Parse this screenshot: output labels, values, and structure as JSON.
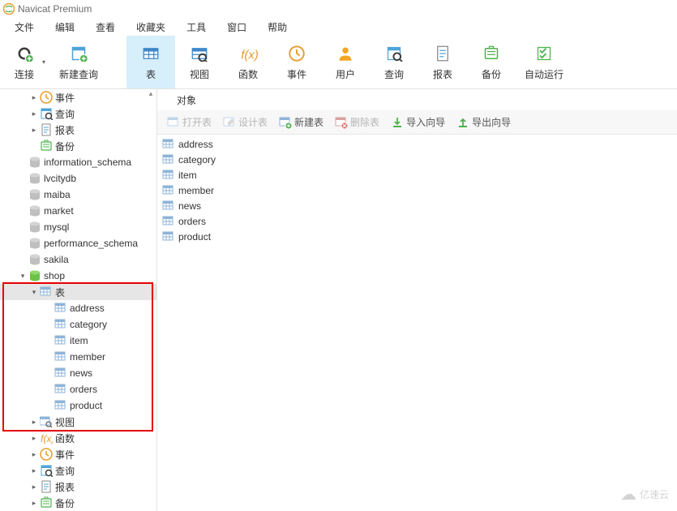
{
  "title": "Navicat Premium",
  "menu": [
    "文件",
    "编辑",
    "查看",
    "收藏夹",
    "工具",
    "窗口",
    "帮助"
  ],
  "toolbar": [
    {
      "id": "connect",
      "label": "连接"
    },
    {
      "id": "newquery",
      "label": "新建查询"
    },
    {
      "id": "table",
      "label": "表",
      "active": true
    },
    {
      "id": "view",
      "label": "视图"
    },
    {
      "id": "function",
      "label": "函数"
    },
    {
      "id": "event",
      "label": "事件"
    },
    {
      "id": "user",
      "label": "用户"
    },
    {
      "id": "query",
      "label": "查询"
    },
    {
      "id": "report",
      "label": "报表"
    },
    {
      "id": "backup",
      "label": "备份"
    },
    {
      "id": "schedule",
      "label": "自动运行"
    }
  ],
  "tree_top": [
    {
      "label": "事件",
      "icon": "event",
      "arrow": ">",
      "indent": 2
    },
    {
      "label": "查询",
      "icon": "query",
      "arrow": ">",
      "indent": 2
    },
    {
      "label": "报表",
      "icon": "report",
      "arrow": ">",
      "indent": 2
    },
    {
      "label": "备份",
      "icon": "backup",
      "arrow": "",
      "indent": 2
    }
  ],
  "databases": [
    {
      "label": "information_schema",
      "active": false
    },
    {
      "label": "lvcitydb",
      "active": false
    },
    {
      "label": "maiba",
      "active": false
    },
    {
      "label": "market",
      "active": false
    },
    {
      "label": "mysql",
      "active": false
    },
    {
      "label": "performance_schema",
      "active": false
    },
    {
      "label": "sakila",
      "active": false
    }
  ],
  "shop_db": {
    "label": "shop"
  },
  "shop_tables_node": {
    "label": "表"
  },
  "shop_tables": [
    "address",
    "category",
    "item",
    "member",
    "news",
    "orders",
    "product"
  ],
  "shop_children": [
    {
      "label": "视图",
      "icon": "view"
    },
    {
      "label": "函数",
      "icon": "fx"
    },
    {
      "label": "事件",
      "icon": "event"
    },
    {
      "label": "查询",
      "icon": "query"
    },
    {
      "label": "报表",
      "icon": "report"
    },
    {
      "label": "备份",
      "icon": "backup"
    }
  ],
  "tab_label": "对象",
  "actions": [
    {
      "label": "打开表",
      "disabled": true,
      "icon": "open"
    },
    {
      "label": "设计表",
      "disabled": true,
      "icon": "design"
    },
    {
      "label": "新建表",
      "disabled": false,
      "icon": "new"
    },
    {
      "label": "删除表",
      "disabled": true,
      "icon": "delete"
    },
    {
      "label": "导入向导",
      "disabled": false,
      "icon": "import"
    },
    {
      "label": "导出向导",
      "disabled": false,
      "icon": "export"
    }
  ],
  "objects": [
    "address",
    "category",
    "item",
    "member",
    "news",
    "orders",
    "product"
  ],
  "watermark": "亿速云"
}
